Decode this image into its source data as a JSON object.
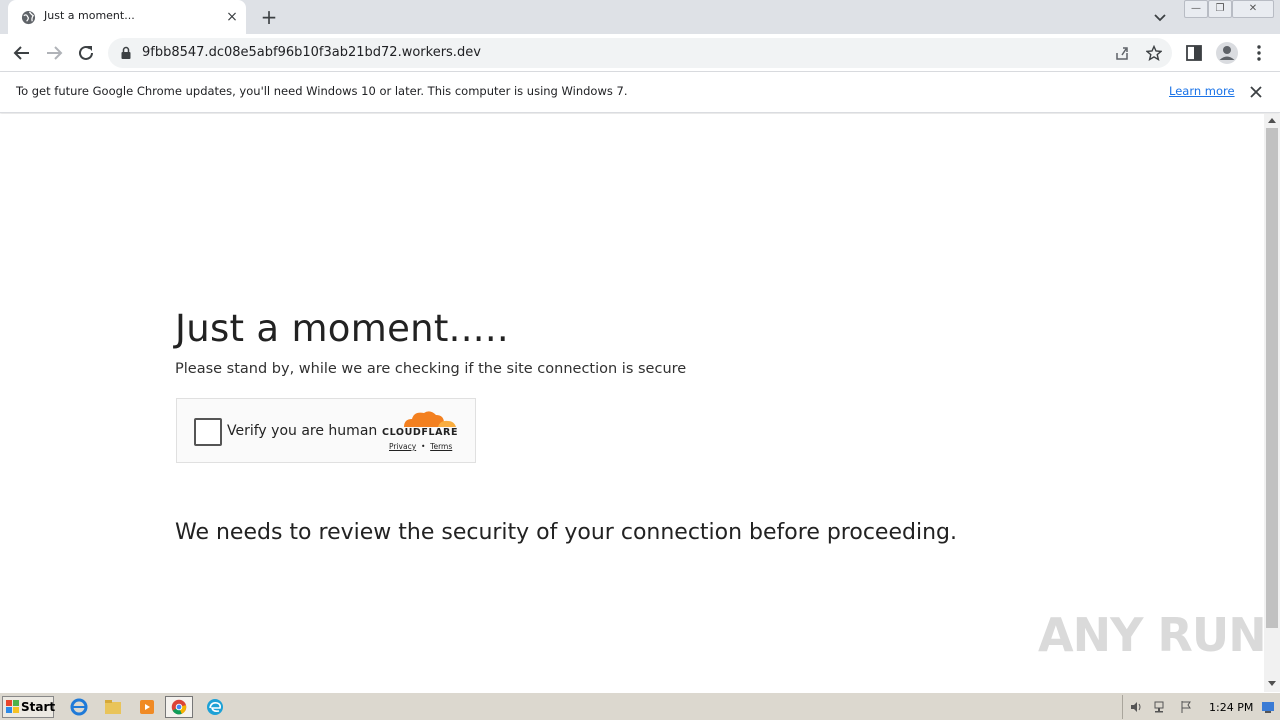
{
  "browser": {
    "tab": {
      "title": "Just a moment...",
      "close_glyph": "×"
    },
    "new_tab_glyph": "+",
    "window_controls": [
      "—",
      "❐",
      "✕"
    ],
    "url": "9fbb8547.dc08e5abf96b10f3ab21bd72.workers.dev",
    "infobar": {
      "message": "To get future Google Chrome updates, you'll need Windows 10 or later. This computer is using Windows 7.",
      "link": "Learn more"
    }
  },
  "page": {
    "heading": "Just a moment.....",
    "subtitle": "Please stand by, while we are checking if the site connection is secure",
    "challenge": {
      "label": "Verify you are human",
      "brand": "CLOUDFLARE",
      "privacy": "Privacy",
      "separator": "•",
      "terms": "Terms"
    },
    "review_text": "We needs to review the security of your connection before proceeding.",
    "watermark": "ANY RUN"
  },
  "taskbar": {
    "start_label": "Start",
    "clock": "1:24 PM"
  },
  "colors": {
    "cloudflare_orange": "#f38020",
    "cloudflare_light": "#faae40",
    "link_blue": "#1a73e8"
  }
}
